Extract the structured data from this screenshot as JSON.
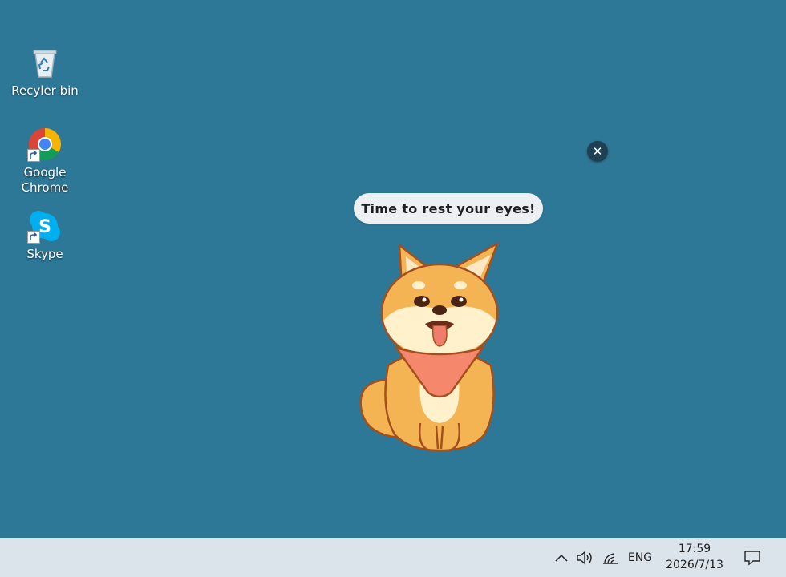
{
  "desktop": {
    "background": "#2e7897",
    "icons": [
      {
        "label": "Recyler bin",
        "icon": "recycle-bin-icon"
      },
      {
        "label": "Google\nChrome",
        "icon": "chrome-icon"
      },
      {
        "label": "Skype",
        "icon": "skype-icon"
      }
    ]
  },
  "reminder": {
    "message": "Time to rest your eyes!",
    "close_glyph": "✕",
    "mascot": "shiba-inu-dog"
  },
  "taskbar": {
    "background": "#dbe4eb",
    "tray": {
      "chevron": "chevron-up-icon",
      "volume": "volume-icon",
      "network": "wifi-icon",
      "language": "ENG",
      "time": "17:59",
      "date": "2026/7/13",
      "notifications": "action-center-icon"
    }
  }
}
